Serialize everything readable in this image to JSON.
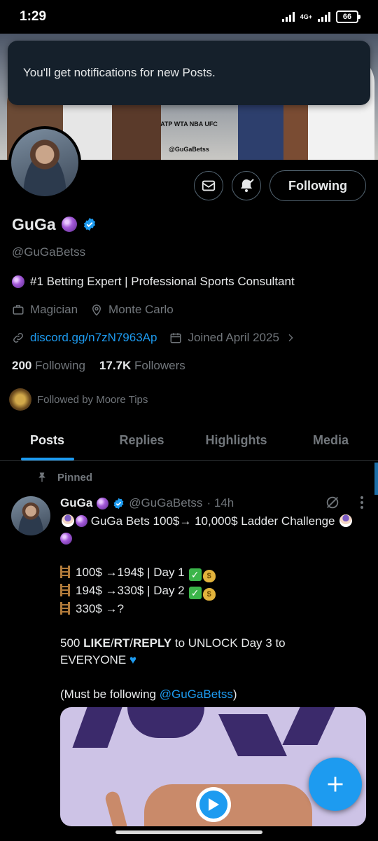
{
  "status_bar": {
    "time": "1:29",
    "network": "4G+",
    "battery": "66"
  },
  "banner": {
    "brand_handle": "@GuGaBetss",
    "sponsor_logos": "ATP WTA NBA UFC"
  },
  "toast": {
    "message": "You'll get notifications for new Posts."
  },
  "actions": {
    "following_label": "Following"
  },
  "profile": {
    "name": "GuGa",
    "handle": "@GuGaBetss",
    "bio": "#1 Betting Expert | Professional Sports Consultant",
    "occupation": "Magician",
    "location": "Monte Carlo",
    "link": "discord.gg/n7zN7963Ap",
    "joined": "Joined April 2025",
    "following_count": "200",
    "following_label": "Following",
    "followers_count": "17.7K",
    "followers_label": "Followers",
    "followed_by": "Followed by Moore Tips"
  },
  "tabs": [
    {
      "label": "Posts",
      "active": true
    },
    {
      "label": "Replies",
      "active": false
    },
    {
      "label": "Highlights",
      "active": false
    },
    {
      "label": "Media",
      "active": false
    }
  ],
  "post": {
    "pinned_label": "Pinned",
    "author_name": "GuGa",
    "author_handle": "@GuGaBetss",
    "time": "· 14h",
    "title_line": "GuGa Bets 100$→ 10,000$ Ladder Challenge",
    "steps": [
      {
        "text": "100$ →194$ | Day 1"
      },
      {
        "text": "194$ →330$ | Day 2"
      },
      {
        "text": "330$ →?"
      }
    ],
    "cta_count": "500",
    "cta_like": "LIKE",
    "cta_rt": "RT",
    "cta_reply": "REPLY",
    "cta_rest": "to UNLOCK Day 3 to EVERYONE",
    "note_open": "(Must be following",
    "note_mention": "@GuGaBetss",
    "note_close": ")"
  },
  "colors": {
    "accent": "#1d9bf0",
    "background": "#000000",
    "muted": "#71767b"
  }
}
